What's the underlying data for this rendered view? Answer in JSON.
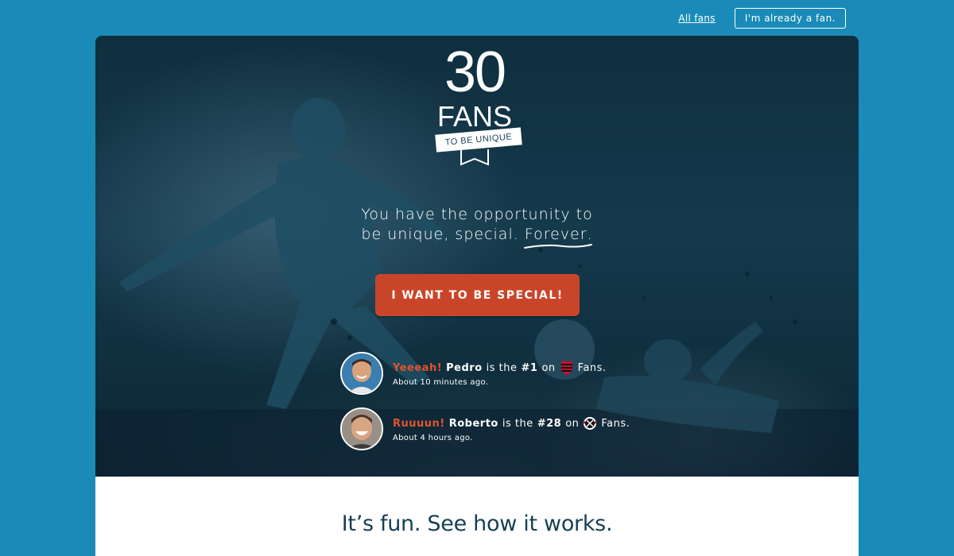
{
  "nav": {
    "all_fans": "All fans",
    "already_fan": "I'm already a fan."
  },
  "logo": {
    "number": "30",
    "word": "FANS",
    "tagline": "TO BE UNIQUE"
  },
  "hero": {
    "headline_line1": "You have the opportunity to",
    "headline_line2_start": "be unique, special. ",
    "headline_highlight": "Forever",
    "headline_end": ".",
    "cta_label": "I WANT TO BE SPECIAL!"
  },
  "feed": [
    {
      "exclaim": "Yeeeah!",
      "name": "Pedro",
      "is_the": "is the",
      "rank": "#1",
      "on": "on",
      "club_icon": "flamengo-crest-icon",
      "fans": "Fans.",
      "time": "About 10 minutes ago."
    },
    {
      "exclaim": "Ruuuun!",
      "name": "Roberto",
      "is_the": "is the",
      "rank": "#28",
      "on": "on",
      "club_icon": "corinthians-crest-icon",
      "fans": "Fans.",
      "time": "About 4 hours ago."
    }
  ],
  "section": {
    "title": "It’s fun. See how it works."
  },
  "colors": {
    "page_bg": "#1a8bb8",
    "hero_bg": "#143a4c",
    "accent": "#c9452a",
    "exclaim": "#e0542f",
    "dark_text": "#163f52"
  }
}
